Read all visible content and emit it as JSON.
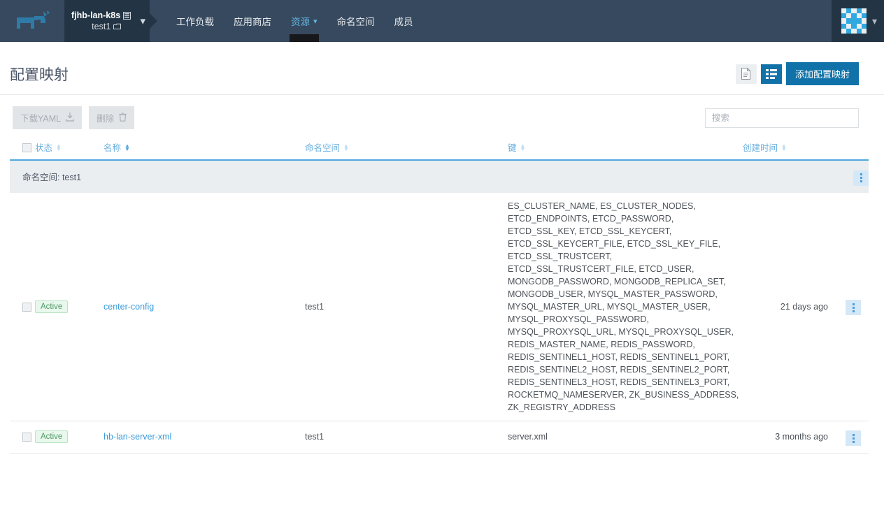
{
  "topnav": {
    "logo_icon": "rancher-cow-logo",
    "cluster": {
      "name": "fjhb-lan-k8s",
      "cluster_icon": "cluster-icon",
      "project": "test1",
      "project_icon": "project-folder-icon",
      "caret_icon": "chevron-down-icon"
    },
    "items": [
      {
        "label": "工作负载",
        "active": false,
        "caret": ""
      },
      {
        "label": "应用商店",
        "active": false,
        "caret": ""
      },
      {
        "label": "资源",
        "active": true,
        "caret": "chevron-down-icon"
      },
      {
        "label": "命名空间",
        "active": false,
        "caret": ""
      },
      {
        "label": "成员",
        "active": false,
        "caret": ""
      }
    ],
    "user": {
      "avatar_icon": "user-identicon-avatar",
      "caret_icon": "chevron-down-icon"
    }
  },
  "page": {
    "title": "配置映射",
    "view_file_icon": "file-view-icon",
    "view_list_icon": "list-view-icon",
    "add_button": "添加配置映射"
  },
  "toolbar": {
    "download_yaml": "下载YAML",
    "download_icon": "download-icon",
    "delete": "删除",
    "delete_icon": "trash-icon",
    "search_placeholder": "搜索",
    "search_value": ""
  },
  "table": {
    "columns": [
      {
        "label": "状态",
        "sorted": false
      },
      {
        "label": "名称",
        "sorted": true
      },
      {
        "label": "命名空间",
        "sorted": false
      },
      {
        "label": "键",
        "sorted": false
      },
      {
        "label": "创建时间",
        "sorted": false
      }
    ],
    "group": {
      "label": "命名空间: test1",
      "menu_icon": "kebab-menu-icon"
    },
    "rows": [
      {
        "status": "Active",
        "name": "center-config",
        "namespace": "test1",
        "keys": "ES_CLUSTER_NAME, ES_CLUSTER_NODES, ETCD_ENDPOINTS, ETCD_PASSWORD, ETCD_SSL_KEY, ETCD_SSL_KEYCERT, ETCD_SSL_KEYCERT_FILE, ETCD_SSL_KEY_FILE, ETCD_SSL_TRUSTCERT, ETCD_SSL_TRUSTCERT_FILE, ETCD_USER, MONGODB_PASSWORD, MONGODB_REPLICA_SET, MONGODB_USER, MYSQL_MASTER_PASSWORD, MYSQL_MASTER_URL, MYSQL_MASTER_USER, MYSQL_PROXYSQL_PASSWORD, MYSQL_PROXYSQL_URL, MYSQL_PROXYSQL_USER, REDIS_MASTER_NAME, REDIS_PASSWORD, REDIS_SENTINEL1_HOST, REDIS_SENTINEL1_PORT, REDIS_SENTINEL2_HOST, REDIS_SENTINEL2_PORT, REDIS_SENTINEL3_HOST, REDIS_SENTINEL3_PORT, ROCKETMQ_NAMESERVER, ZK_BUSINESS_ADDRESS, ZK_REGISTRY_ADDRESS",
        "created": "21 days ago",
        "menu_icon": "kebab-menu-icon"
      },
      {
        "status": "Active",
        "name": "hb-lan-server-xml",
        "namespace": "test1",
        "keys": "server.xml",
        "created": "3 months ago",
        "menu_icon": "kebab-menu-icon"
      }
    ]
  },
  "colors": {
    "nav_bg": "#37495e",
    "nav_dark": "#233545",
    "accent": "#1072a8",
    "link": "#3a9ad9",
    "header_text": "#6ab0de",
    "status_green": "#4f9a66"
  }
}
